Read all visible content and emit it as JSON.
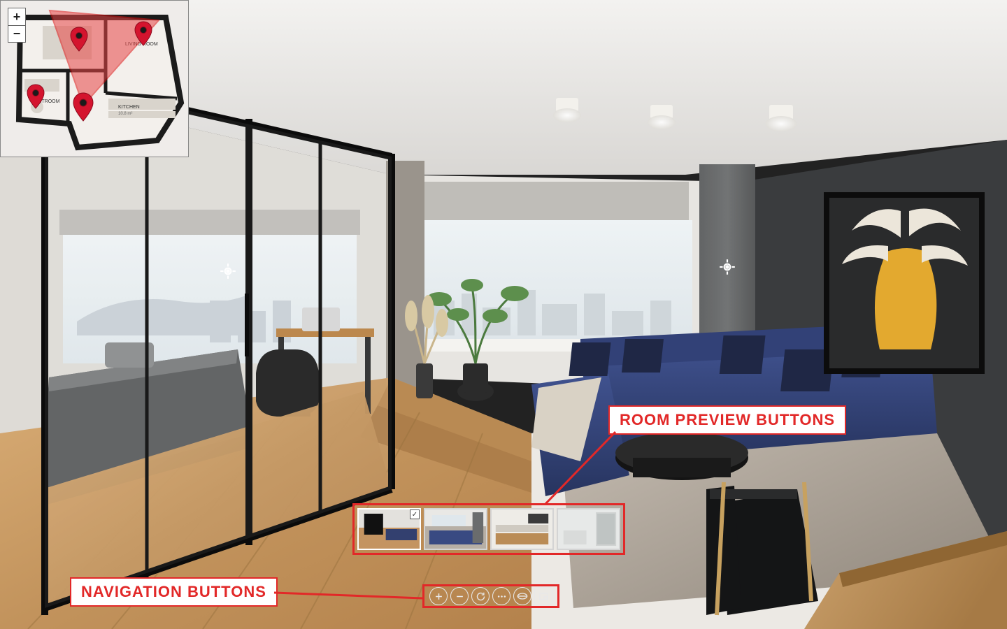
{
  "minimap": {
    "zoom_in": "+",
    "zoom_out": "−",
    "rooms": {
      "restroom": "RESTROOM",
      "kitchen": "KITCHEN",
      "living": "LIVING ROOM"
    },
    "kitchen_dim": "10.8 m²"
  },
  "annotations": {
    "room_preview": "ROOM PREVIEW BUTTONS",
    "navigation": "NAVIGATION BUTTONS"
  },
  "previews": [
    {
      "name": "living-room",
      "active": true
    },
    {
      "name": "bedroom",
      "active": false
    },
    {
      "name": "kitchen",
      "active": false
    },
    {
      "name": "bathroom",
      "active": false
    }
  ],
  "nav": {
    "zoom_in": "zoom-in",
    "zoom_out": "zoom-out",
    "reset": "reset-view",
    "more": "more-options",
    "pano": "panorama-mode",
    "fullscreen": "fullscreen"
  },
  "colors": {
    "accent": "#e22828",
    "sofa": "#2e3f7a",
    "wall_dark": "#3a3c3e",
    "floor_wood": "#c79a62",
    "rug": "#a79d92"
  }
}
